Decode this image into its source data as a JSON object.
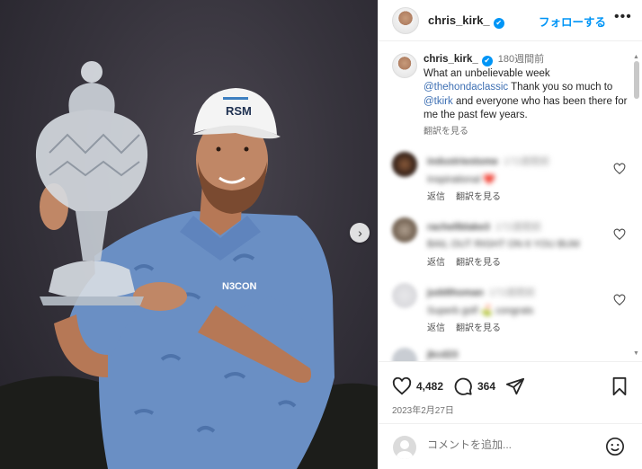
{
  "post": {
    "username": "chris_kirk_",
    "follow_label": "フォローする",
    "more_label": "•••",
    "caption": {
      "username": "chris_kirk_",
      "time_ago": "180週間前",
      "text_1": "What an unbelievable week",
      "mention_1": "@thehondaclassic",
      "text_2": " Thank you so much to ",
      "mention_2": "@tkirk",
      "text_3": " and everyone who has been there for me the past few years.",
      "translate": "翻訳を見る"
    },
    "comments": [
      {
        "user": "industriestome",
        "time": "172週間前",
        "text": "Inspirational ❤️",
        "reply": "返信",
        "translate": "翻訳を見る"
      },
      {
        "user": "rachellblake3",
        "time": "172週間前",
        "text": "BAIL OUT RIGHT ON 6 YOU BUM",
        "reply": "返信",
        "translate": "翻訳を見る"
      },
      {
        "user": "juddthoman",
        "time": "172週間前",
        "text": "Superb golf ⛳ congrats",
        "reply": "返信",
        "translate": "翻訳を見る"
      },
      {
        "user": "jkcd23",
        "time": "",
        "text": "",
        "reply": "",
        "translate": ""
      }
    ],
    "likes": "4,482",
    "comment_count": "364",
    "date": "2023年2月27日",
    "comment_placeholder": "コメントを追加...",
    "photo": {
      "cap_text": "RSM",
      "shirt_text": "N3CON"
    }
  },
  "colors": {
    "accent": "#0095f6",
    "mention": "#3d6fb3",
    "shirt": "#6a8fc4"
  },
  "icons": [
    "heart-icon",
    "comment-icon",
    "share-icon",
    "bookmark-icon",
    "emoji-icon",
    "chevron-right-icon",
    "verified-icon"
  ]
}
